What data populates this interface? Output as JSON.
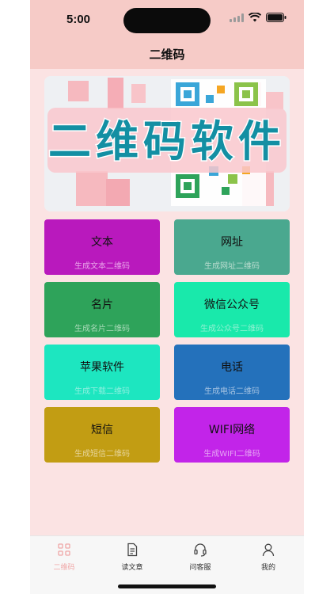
{
  "status": {
    "time": "5:00"
  },
  "nav": {
    "title": "二维码"
  },
  "banner": {
    "text": "二维码软件"
  },
  "cards": [
    {
      "title": "文本",
      "subtitle": "生成文本二维码",
      "color": "#b919bd",
      "sub_color": "#e9a6ea"
    },
    {
      "title": "网址",
      "subtitle": "生成网址二维码",
      "color": "#4aa88f",
      "sub_color": "#b9dccf"
    },
    {
      "title": "名片",
      "subtitle": "生成名片二维码",
      "color": "#2ea35a",
      "sub_color": "#a9d9b8"
    },
    {
      "title": "微信公众号",
      "subtitle": "生成公众号二维码",
      "color": "#19e9ab",
      "sub_color": "#8ff0d1"
    },
    {
      "title": "苹果软件",
      "subtitle": "生成下载二维码",
      "color": "#1de6c0",
      "sub_color": "#8fefdf"
    },
    {
      "title": "电话",
      "subtitle": "生成电话二维码",
      "color": "#2471bb",
      "sub_color": "#a4c2e2"
    },
    {
      "title": "短信",
      "subtitle": "生成短信二维码",
      "color": "#c29d13",
      "sub_color": "#e7d59a"
    },
    {
      "title": "WIFI网络",
      "subtitle": "生成WIFI二维码",
      "color": "#c224e9",
      "sub_color": "#e6a4f4"
    }
  ],
  "tabs": [
    {
      "label": "二维码",
      "icon": "qr-grid-icon",
      "active": true
    },
    {
      "label": "读文章",
      "icon": "document-icon",
      "active": false
    },
    {
      "label": "问客服",
      "icon": "headset-icon",
      "active": false
    },
    {
      "label": "我的",
      "icon": "person-icon",
      "active": false
    }
  ],
  "colors": {
    "topbar": "#f6cbc7",
    "background": "#fbe3e3",
    "tab_active": "#f0a7a7"
  }
}
